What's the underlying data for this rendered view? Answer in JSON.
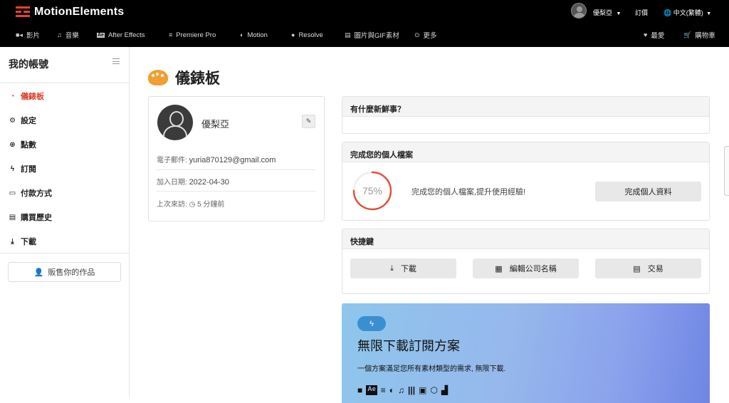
{
  "header": {
    "brand": "MotionElements",
    "user_name": "優梨亞",
    "subscribe_label": "訂價",
    "language": "中文(繁體)"
  },
  "nav": {
    "items": [
      {
        "label": "影片",
        "icon": "video-icon"
      },
      {
        "label": "音樂",
        "icon": "music-icon"
      },
      {
        "label": "After Effects",
        "icon": "after-effects-icon"
      },
      {
        "label": "Premiere Pro",
        "icon": "premiere-pro-icon"
      },
      {
        "label": "Motion",
        "icon": "motion-icon"
      },
      {
        "label": "Resolve",
        "icon": "resolve-icon"
      },
      {
        "label": "圖片與GIF素材",
        "icon": "image-icon"
      },
      {
        "label": "更多",
        "icon": "more-icon"
      }
    ],
    "favorites_label": "最愛",
    "cart_label": "購物車"
  },
  "sidebar": {
    "title": "我的帳號",
    "items": [
      {
        "label": "儀錶板",
        "icon": "dashboard-icon",
        "active": true
      },
      {
        "label": "設定",
        "icon": "gear-icon"
      },
      {
        "label": "點數",
        "icon": "points-icon"
      },
      {
        "label": "訂閱",
        "icon": "bolt-icon"
      },
      {
        "label": "付款方式",
        "icon": "credit-card-icon"
      },
      {
        "label": "購買歷史",
        "icon": "receipt-icon"
      },
      {
        "label": "下載",
        "icon": "download-icon"
      }
    ],
    "sell_button": "販售你的作品"
  },
  "main": {
    "title": "儀錶板",
    "profile": {
      "name": "優梨亞",
      "email_label": "電子郵件:",
      "email": "yuria870129@gmail.com",
      "joined_label": "加入日期:",
      "joined": "2022-04-30",
      "last_visit_label": "上次來訪:",
      "last_visit": "5 分鐘前"
    },
    "whats_new": {
      "title": "有什麼新鮮事？"
    },
    "profile_completion": {
      "title": "完成您的個人檔案",
      "percent_value": 75,
      "percent": "75%",
      "text": "完成您的個人檔案,提升使用經驗!",
      "button": "完成個人資料"
    },
    "shortcuts": {
      "title": "快捷鍵",
      "buttons": [
        {
          "label": "下載",
          "icon": "download-icon"
        },
        {
          "label": "編輯公司名稱",
          "icon": "building-icon"
        },
        {
          "label": "交易",
          "icon": "document-icon"
        }
      ]
    },
    "promo": {
      "title": "無限下載訂閱方案",
      "subtitle": "一個方案滿足您所有素材類型的需求, 無限下載.",
      "badge_icon": "bolt-icon"
    }
  },
  "colors": {
    "accent": "#d9412a",
    "progress": "#e2533a",
    "promo_start": "#8ec6ec",
    "promo_end": "#6f86e4"
  }
}
